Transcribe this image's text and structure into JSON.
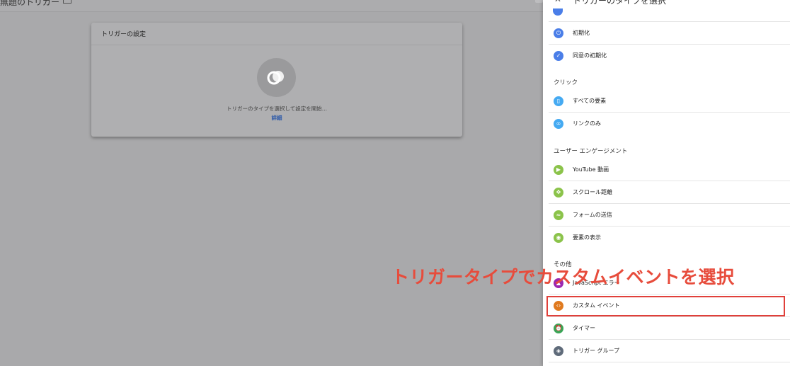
{
  "topbar": {
    "title": "無題のトリガー"
  },
  "card": {
    "header": "トリガーの設定",
    "hint": "トリガーのタイプを選択して設定を開始...",
    "link": "詳細"
  },
  "panel": {
    "close_symbol": "✕",
    "title": "トリガーのタイプを選択",
    "items_top": [
      {
        "label": "初期化",
        "icon": "power-icon",
        "color": "#4a7ee8"
      },
      {
        "label": "同意の初期化",
        "icon": "consent-icon",
        "color": "#4a7ee8"
      }
    ],
    "sections": [
      {
        "title": "クリック",
        "items": [
          {
            "label": "すべての要素",
            "icon": "mouse-icon",
            "color": "#45aaf2"
          },
          {
            "label": "リンクのみ",
            "icon": "link-icon",
            "color": "#45aaf2"
          }
        ]
      },
      {
        "title": "ユーザー エンゲージメント",
        "items": [
          {
            "label": "YouTube 動画",
            "icon": "play-icon",
            "color": "#8bc34a"
          },
          {
            "label": "スクロール距離",
            "icon": "scroll-icon",
            "color": "#8bc34a"
          },
          {
            "label": "フォームの送信",
            "icon": "form-icon",
            "color": "#8bc34a"
          },
          {
            "label": "要素の表示",
            "icon": "eye-icon",
            "color": "#8bc34a"
          }
        ]
      },
      {
        "title": "その他",
        "items": [
          {
            "label": "JavaScript エラー",
            "icon": "warning-icon",
            "color": "#9c27b0"
          },
          {
            "label": "カスタム イベント",
            "icon": "code-icon",
            "color": "#e07a1f"
          },
          {
            "label": "タイマー",
            "icon": "timer-icon",
            "color": "#3aa556"
          },
          {
            "label": "トリガー グループ",
            "icon": "group-icon",
            "color": "#5f6b7a"
          }
        ]
      }
    ]
  },
  "annotation": {
    "text": "トリガータイプでカスタムイベントを選択",
    "color": "#e74c3c"
  }
}
